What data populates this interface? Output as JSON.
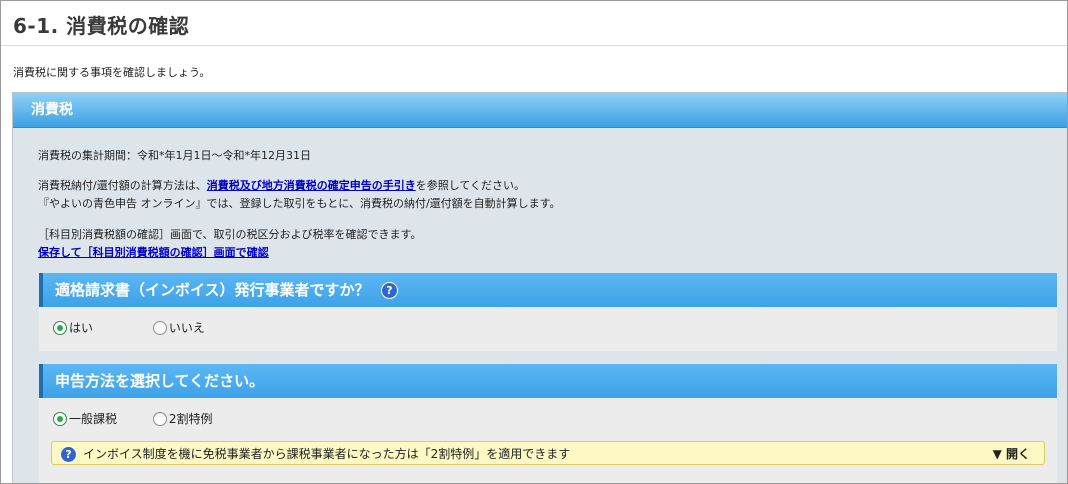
{
  "page": {
    "title": "6-1. 消費税の確認",
    "intro": "消費税に関する事項を確認しましょう。"
  },
  "panel": {
    "header": "消費税",
    "period_text": "消費税の集計期間：令和*年1月1日～令和*年12月31日",
    "calc_prefix": "消費税納付/還付額の計算方法は、",
    "calc_link": "消費税及び地方消費税の確定申告の手引き",
    "calc_suffix": "を参照してください。",
    "auto_calc": "『やよいの青色申告 オンライン』では、登録した取引をもとに、消費税の納付/還付額を自動計算します。",
    "rate_check": "［科目別消費税額の確認］画面で、取引の税区分および税率を確認できます。",
    "rate_link": "保存して［科目別消費税額の確認］画面で確認"
  },
  "invoice_section": {
    "header": "適格請求書（インボイス）発行事業者ですか？",
    "help_icon": "?",
    "options": [
      {
        "label": "はい",
        "checked": true
      },
      {
        "label": "いいえ",
        "checked": false
      }
    ]
  },
  "method_section": {
    "header": "申告方法を選択してください。",
    "options": [
      {
        "label": "一般課税",
        "checked": true
      },
      {
        "label": "2割特例",
        "checked": false
      }
    ],
    "notice": {
      "help_icon": "?",
      "text": "インボイス制度を機に免税事業者から課税事業者になった方は「2割特例」を適用できます",
      "toggle": "▼ 開く"
    }
  },
  "colors": {
    "panel_header": "#3ba0e2",
    "section_header": "#4aaaee",
    "radio_selected": "#2fa84f",
    "notice_bg": "#fdf9c4"
  }
}
